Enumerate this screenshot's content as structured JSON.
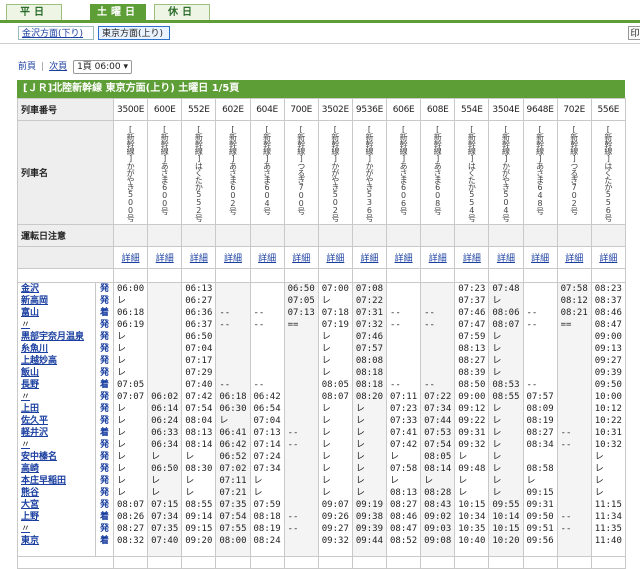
{
  "tabs": [
    {
      "label": "平日",
      "active": false
    },
    {
      "label": "土曜日",
      "active": true
    },
    {
      "label": "休日",
      "active": false
    }
  ],
  "directions": [
    {
      "label": "金沢方面(下り)",
      "selected": false
    },
    {
      "label": "東京方面(上り)",
      "selected": true
    }
  ],
  "right_button_label": "印",
  "pager": {
    "prev": "前頁",
    "next": "次頁",
    "select": "1頁 06:00 ▾"
  },
  "header_title": "[ＪＲ]北陸新幹線 東京方面(上り) 土曜日 1/5頁",
  "row_labels": {
    "train_no": "列車番号",
    "train_name": "列車名",
    "notes": "運転日注意"
  },
  "detail_label": "詳細",
  "trains": [
    {
      "no": "3500E",
      "name": "[新幹線]かがやき500号"
    },
    {
      "no": "600E",
      "name": "[新幹線]あさま600号"
    },
    {
      "no": "552E",
      "name": "[新幹線]はくたか552号"
    },
    {
      "no": "602E",
      "name": "[新幹線]あさま602号"
    },
    {
      "no": "604E",
      "name": "[新幹線]あさま604号"
    },
    {
      "no": "700E",
      "name": "[新幹線]つるぎ700号"
    },
    {
      "no": "3502E",
      "name": "[新幹線]かがやき502号"
    },
    {
      "no": "9536E",
      "name": "[新幹線]かがやき536号"
    },
    {
      "no": "606E",
      "name": "[新幹線]あさま606号"
    },
    {
      "no": "608E",
      "name": "[新幹線]あさま608号"
    },
    {
      "no": "554E",
      "name": "[新幹線]はくたか554号"
    },
    {
      "no": "3504E",
      "name": "[新幹線]かがやき504号"
    },
    {
      "no": "9648E",
      "name": "[新幹線]あさま648号"
    },
    {
      "no": "702E",
      "name": "[新幹線]つるぎ702号"
    },
    {
      "no": "556E",
      "name": "[新幹線]はくたか556号"
    }
  ],
  "stations_text": "金沢\n新高岡\n富山\n〃\n黒部宇奈月温泉\n糸魚川\n上越妙高\n飯山\n長野\n〃\n上田\n佐久平\n軽井沢\n〃\n安中榛名\n高崎\n本庄早稲田\n熊谷\n大宮\n上野\n〃\n東京",
  "kinds_text": "発\n発\n着\n発\n発\n発\n発\n発\n着\n発\n発\n発\n着\n発\n発\n発\n発\n発\n発\n着\n発\n着",
  "times": [
    "06:00\nレ\n06:18\n06:19\nレ\nレ\nレ\nレ\n07:05\n07:07\nレ\nレ\nレ\nレ\nレ\nレ\nレ\nレ\n08:07\n08:26\n08:27\n08:32",
    "\n\n\n\n\n\n\n\n\n06:02\n06:14\n06:24\n06:33\n06:34\nレ\n06:50\nレ\nレ\n07:15\n07:34\n07:35\n07:40",
    "06:13\n06:27\n06:36\n06:37\n06:50\n07:04\n07:17\n07:29\n07:40\n07:42\n07:54\n08:04\n08:13\n08:14\nレ\n08:30\nレ\nレ\n08:55\n09:14\n09:15\n09:20",
    "\n\n--\n--\n\n\n\n\n--\n06:18\n06:30\nレ\n06:41\n06:42\n06:52\n07:02\n07:11\n07:21\n07:35\n07:54\n07:55\n08:00",
    "\n\n--\n--\n\n\n\n\n--\n06:42\n06:54\n07:04\n07:13\n07:14\n07:24\n07:34\nレ\nレ\n07:59\n08:18\n08:19\n08:24",
    "06:50\n07:05\n07:13\n==\n\n\n\n\n\n\n\n\n--\n--\n\n\n\n\n\n--\n--\n",
    "07:00\nレ\n07:18\n07:19\nレ\nレ\nレ\nレ\n08:05\n08:07\nレ\nレ\nレ\nレ\nレ\nレ\nレ\nレ\n09:07\n09:26\n09:27\n09:32",
    "07:08\n07:22\n07:31\n07:32\n07:46\n07:57\n08:08\n08:18\n08:18\n08:20\nレ\nレ\nレ\nレ\nレ\nレ\nレ\nレ\n09:19\n09:38\n09:39\n09:44",
    "\n\n--\n--\n\n\n\n\n--\n07:11\n07:23\n07:33\n07:41\n07:42\nレ\n07:58\nレ\n08:13\n08:27\n08:46\n08:47\n08:52",
    "\n\n--\n--\n\n\n\n\n--\n07:22\n07:34\n07:44\n07:53\n07:54\n08:05\n08:14\nレ\n08:28\n08:43\n09:02\n09:03\n09:08",
    "07:23\n07:37\n07:46\n07:47\n07:59\n08:13\n08:27\n08:39\n08:50\n09:00\n09:12\n09:22\n09:31\n09:32\nレ\n09:48\nレ\nレ\n10:15\n10:34\n10:35\n10:40",
    "07:48\nレ\n08:06\n08:07\nレ\nレ\nレ\nレ\n08:53\n08:55\nレ\nレ\nレ\nレ\nレ\nレ\nレ\nレ\n09:55\n10:14\n10:15\n10:20",
    "\n\n--\n--\n\n\n\n\n--\n07:57\n08:09\n08:19\n08:27\n08:34\n\n08:58\nレ\n09:15\n09:31\n09:50\n09:51\n09:56",
    "07:58\n08:12\n08:21\n==\n\n\n\n\n\n\n\n\n--\n--\n\n\n\n\n\n--\n--\n",
    "08:23\n08:37\n08:46\n08:47\n09:00\n09:13\n09:27\n09:39\n09:50\n10:00\n10:12\n10:22\n10:31\n10:32\nレ\nレ\nレ\nレ\n11:15\n11:34\n11:35\n11:40"
  ]
}
